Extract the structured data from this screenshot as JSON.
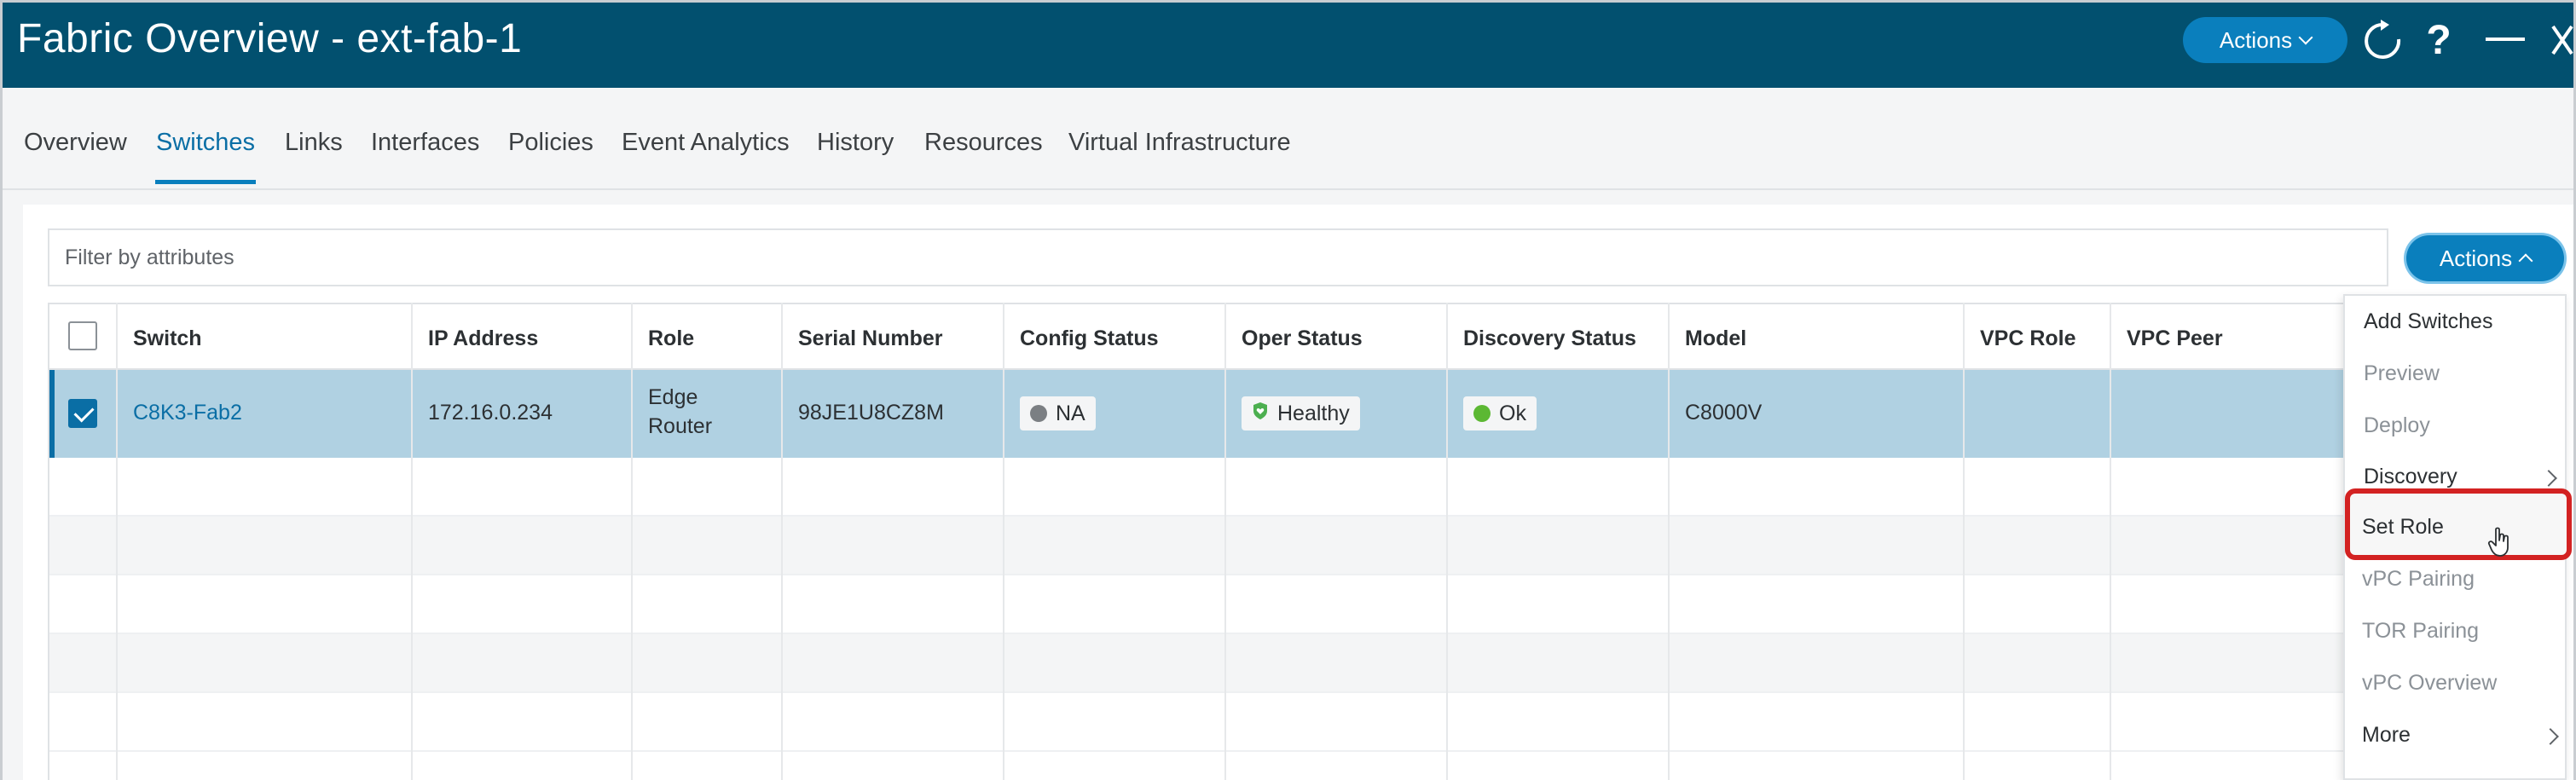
{
  "header": {
    "title": "Fabric Overview - ext-fab-1",
    "actions_label": "Actions",
    "icons": [
      "refresh-icon",
      "help-icon",
      "minimize-icon",
      "close-icon"
    ],
    "help_glyph": "?"
  },
  "tabs": [
    {
      "label": "Overview"
    },
    {
      "label": "Switches",
      "active": true
    },
    {
      "label": "Links"
    },
    {
      "label": "Interfaces"
    },
    {
      "label": "Policies"
    },
    {
      "label": "Event Analytics"
    },
    {
      "label": "History"
    },
    {
      "label": "Resources"
    },
    {
      "label": "Virtual Infrastructure"
    }
  ],
  "filter": {
    "placeholder": "Filter by attributes"
  },
  "panel_actions": {
    "label": "Actions"
  },
  "table": {
    "headers": [
      "Switch",
      "IP Address",
      "Role",
      "Serial Number",
      "Config Status",
      "Oper Status",
      "Discovery Status",
      "Model",
      "VPC Role",
      "VPC Peer"
    ],
    "rows": [
      {
        "selected": true,
        "switch": "C8K3-Fab2",
        "ip": "172.16.0.234",
        "role_line1": "Edge",
        "role_line2": "Router",
        "serial": "98JE1U8CZ8M",
        "config_status": "NA",
        "oper_status": "Healthy",
        "discovery_status": "Ok",
        "model": "C8000V",
        "vpc_role": "",
        "vpc_peer": ""
      }
    ]
  },
  "colors": {
    "header_bg": "#02506f",
    "accent": "#0a7fbd",
    "selected_row": "#b0d1e2",
    "highlight": "#d32222",
    "status_na": "#7b7f83",
    "status_healthy": "#4caf50",
    "status_ok": "#5cb833"
  },
  "menu": {
    "items": [
      {
        "label": "Add Switches",
        "enabled": true
      },
      {
        "label": "Preview",
        "enabled": false
      },
      {
        "label": "Deploy",
        "enabled": false
      },
      {
        "label": "Discovery",
        "enabled": true,
        "submenu": true
      },
      {
        "label": "Set Role",
        "enabled": true,
        "highlighted": true
      },
      {
        "label": "vPC Pairing",
        "enabled": false
      },
      {
        "label": "TOR Pairing",
        "enabled": false
      },
      {
        "label": "vPC Overview",
        "enabled": false
      },
      {
        "label": "More",
        "enabled": true,
        "submenu": true
      }
    ]
  }
}
